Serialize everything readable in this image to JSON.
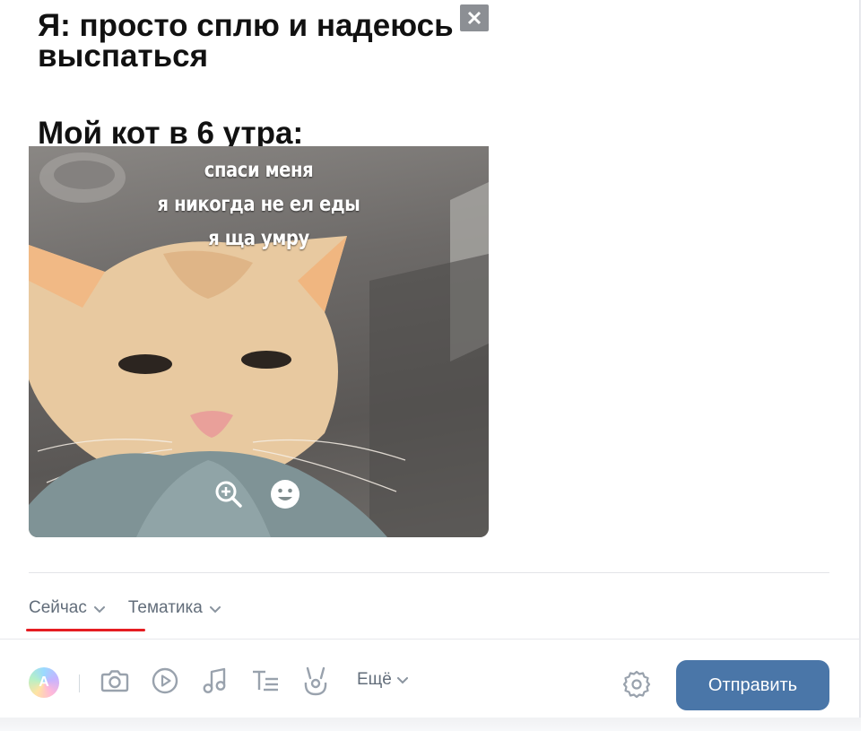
{
  "attachment": {
    "meme_line1": "Я: просто сплю и надеюсь выспаться",
    "meme_line2": "Мой кот в 6 утра:",
    "caption_line1": "спаси меня",
    "caption_line2": "я никогда не ел еды",
    "caption_line3": "я ща умру",
    "icons": [
      "close-icon",
      "zoom-in-icon",
      "emoji-icon"
    ]
  },
  "meta": {
    "time_label": "Сейчас",
    "topic_label": "Тематика"
  },
  "toolbar": {
    "avatar_letter": "A",
    "icons": [
      "photo-icon",
      "video-icon",
      "music-icon",
      "text-icon",
      "gesture-icon",
      "settings-icon"
    ],
    "more_label": "Ещё",
    "send_label": "Отправить"
  },
  "colors": {
    "send_button": "#4a76a8",
    "muted_text": "#626d7a",
    "active_underline": "#e51d22"
  }
}
